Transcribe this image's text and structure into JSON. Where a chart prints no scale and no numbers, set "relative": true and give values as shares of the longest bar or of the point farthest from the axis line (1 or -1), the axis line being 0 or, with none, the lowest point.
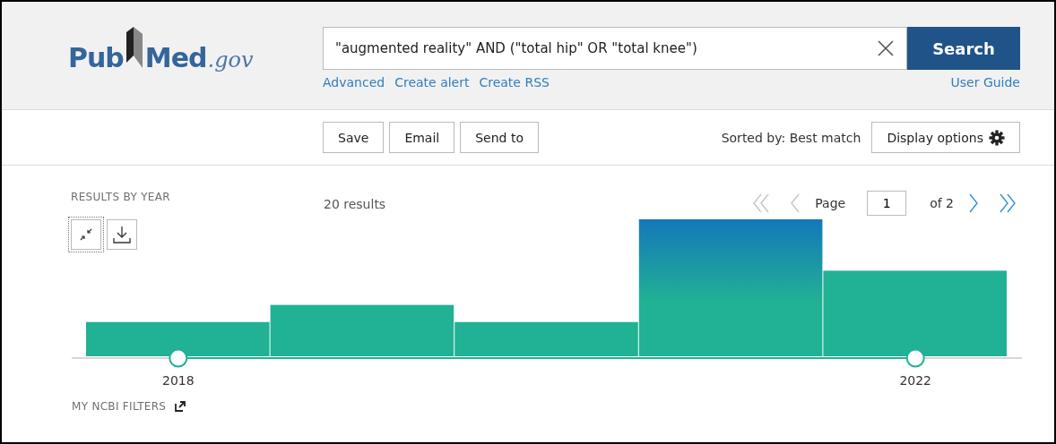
{
  "header": {
    "logo": {
      "parts": [
        "Pub",
        "Med",
        ".gov"
      ]
    },
    "search": {
      "value": "\"augmented reality\" AND (\"total hip\" OR \"total knee\")",
      "button": "Search"
    },
    "links": [
      "Advanced",
      "Create alert",
      "Create RSS"
    ],
    "user_guide": "User Guide"
  },
  "toolbar": {
    "actions": [
      "Save",
      "Email",
      "Send to"
    ],
    "sort_label": "Sorted by: Best match",
    "display_options": "Display options"
  },
  "timeline": {
    "title": "RESULTS BY YEAR",
    "tools": [
      {
        "kind": "collapse",
        "focused": true
      },
      {
        "kind": "download",
        "focused": false
      }
    ],
    "bar_states": [
      {
        "hovered": false
      },
      {
        "hovered": false
      },
      {
        "hovered": false
      },
      {
        "hovered": true
      },
      {
        "hovered": false
      }
    ],
    "chart_data": {
      "type": "bar",
      "relative": true,
      "x": [
        2018,
        2019,
        2020,
        2021,
        2022
      ],
      "values": [
        0.25,
        0.375,
        0.25,
        1,
        0.625
      ],
      "xlim": [
        2017.5,
        2022.5
      ],
      "xticks": [
        2018,
        2022
      ]
    }
  },
  "results": {
    "count": "20 results",
    "pagination": {
      "page_label": "Page",
      "page": "1",
      "total": "of 2",
      "buttons": [
        {
          "kind": "first",
          "disabled": true
        },
        {
          "kind": "prev",
          "disabled": true
        },
        {
          "kind": "next",
          "disabled": false
        },
        {
          "kind": "last",
          "disabled": false
        }
      ]
    }
  },
  "filters": {
    "title": "MY NCBI FILTERS"
  }
}
